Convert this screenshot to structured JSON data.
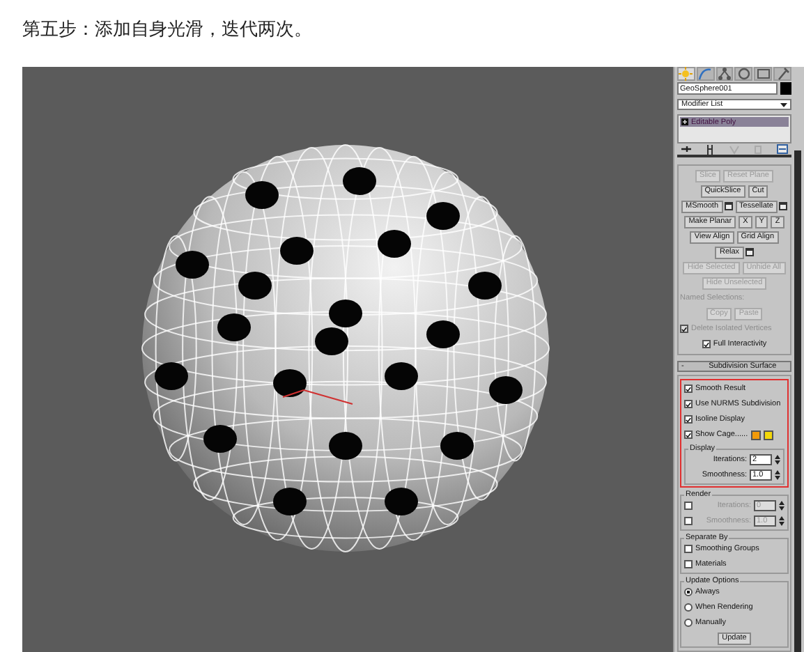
{
  "heading": "第五步：添加自身光滑，迭代两次。",
  "panel": {
    "tabs": [
      {
        "selected": true
      },
      {
        "selected": false
      },
      {
        "selected": false
      },
      {
        "selected": false
      },
      {
        "selected": false
      },
      {
        "selected": false
      }
    ],
    "object_name": "GeoSphere001",
    "modifier_list": "Modifier List",
    "stack": [
      {
        "label": "Editable Poly",
        "selected": true
      }
    ],
    "rollouts": [
      {
        "rows": [
          {
            "kind": "buttons",
            "items": [
              {
                "label": "Slice",
                "disabled": true,
                "settings": false
              },
              {
                "label": "Reset Plane",
                "disabled": true,
                "settings": false
              }
            ]
          },
          {
            "kind": "buttons",
            "items": [
              {
                "label": "QuickSlice",
                "disabled": false,
                "settings": false
              },
              {
                "label": "Cut",
                "disabled": false,
                "settings": false
              }
            ]
          },
          {
            "kind": "buttons",
            "items": [
              {
                "label": "MSmooth",
                "disabled": false,
                "settings": true
              },
              {
                "label": "Tessellate",
                "disabled": false,
                "settings": true
              }
            ]
          },
          {
            "kind": "buttons",
            "items": [
              {
                "label": "Make Planar",
                "disabled": false,
                "settings": false
              },
              {
                "label": "X",
                "disabled": false,
                "settings": false
              },
              {
                "label": "Y",
                "disabled": false,
                "settings": false
              },
              {
                "label": "Z",
                "disabled": false,
                "settings": false
              }
            ]
          },
          {
            "kind": "buttons",
            "items": [
              {
                "label": "View Align",
                "disabled": false,
                "settings": false
              },
              {
                "label": "Grid Align",
                "disabled": false,
                "settings": false
              }
            ]
          },
          {
            "kind": "buttons",
            "items": [
              {
                "label": "Relax",
                "disabled": false,
                "settings": true
              }
            ]
          },
          {
            "kind": "buttons",
            "items": [
              {
                "label": "Hide Selected",
                "disabled": true,
                "settings": false
              },
              {
                "label": "Unhide All",
                "disabled": true,
                "settings": false
              }
            ]
          },
          {
            "kind": "buttons",
            "items": [
              {
                "label": "Hide Unselected",
                "disabled": true,
                "settings": false
              }
            ]
          },
          {
            "kind": "label",
            "text": "Named Selections:",
            "disabled": true
          },
          {
            "kind": "buttons",
            "items": [
              {
                "label": "Copy",
                "disabled": true,
                "settings": false
              },
              {
                "label": "Paste",
                "disabled": true,
                "settings": false
              }
            ]
          },
          {
            "kind": "checkbox",
            "label": "Delete Isolated Vertices",
            "checked": true,
            "disabled": true
          },
          {
            "kind": "checkbox",
            "label": "Full Interactivity",
            "checked": true,
            "disabled": false,
            "centered": true
          }
        ]
      },
      {
        "toggle": "-",
        "title": "Subdivision Surface",
        "rows": [
          {
            "kind": "highlight",
            "rows": [
              {
                "kind": "checkbox",
                "label": "Smooth Result",
                "checked": true,
                "disabled": false
              },
              {
                "kind": "checkbox",
                "label": "Use NURMS Subdivision",
                "checked": true,
                "disabled": false
              },
              {
                "kind": "checkbox",
                "label": "Isoline Display",
                "checked": true,
                "disabled": false
              },
              {
                "kind": "checkbox",
                "label": "Show Cage......",
                "checked": true,
                "disabled": false,
                "swatches": [
                  {
                    "color": "#f29a0a"
                  },
                  {
                    "color": "#f2d70a"
                  }
                ]
              },
              {
                "kind": "group",
                "title": "Display",
                "rows": [
                  {
                    "kind": "spinner",
                    "label": "Iterations:",
                    "value": "2",
                    "disabled": false
                  },
                  {
                    "kind": "spinner",
                    "label": "Smoothness:",
                    "value": "1.0",
                    "disabled": false
                  }
                ]
              }
            ]
          },
          {
            "kind": "group",
            "title": "Render",
            "rows": [
              {
                "kind": "spinner",
                "label": "Iterations:",
                "value": "0",
                "disabled": true,
                "checked": false
              },
              {
                "kind": "spinner",
                "label": "Smoothness:",
                "value": "1.0",
                "disabled": true,
                "checked": false
              }
            ]
          },
          {
            "kind": "group",
            "title": "Separate By",
            "rows": [
              {
                "kind": "checkbox",
                "label": "Smoothing Groups",
                "checked": false,
                "disabled": false
              },
              {
                "kind": "checkbox",
                "label": "Materials",
                "checked": false,
                "disabled": false
              }
            ]
          },
          {
            "kind": "group",
            "title": "Update Options",
            "rows": [
              {
                "kind": "radio",
                "label": "Always",
                "selected": true
              },
              {
                "kind": "radio",
                "label": "When Rendering",
                "selected": false
              },
              {
                "kind": "radio",
                "label": "Manually",
                "selected": false
              },
              {
                "kind": "buttons",
                "items": [
                  {
                    "label": "Update",
                    "disabled": false,
                    "settings": false
                  }
                ]
              }
            ]
          }
        ]
      }
    ]
  }
}
